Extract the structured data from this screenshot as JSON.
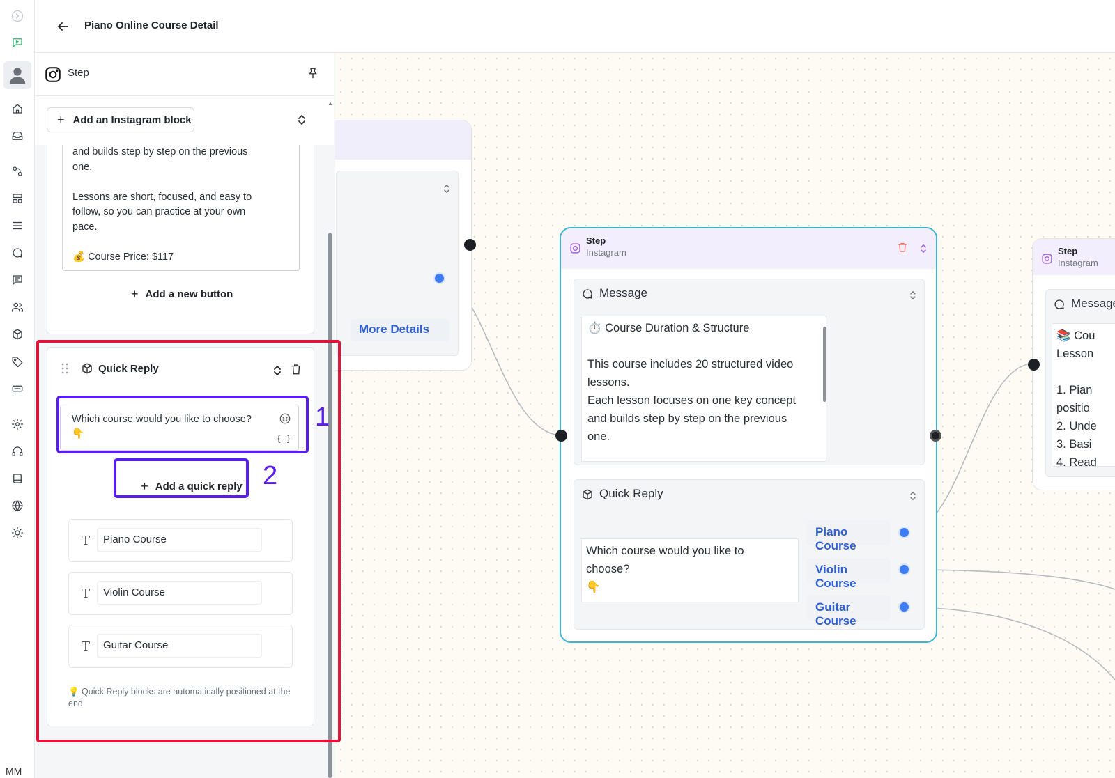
{
  "header": {
    "title": "Piano Online Course Detail"
  },
  "rail": {
    "user_initials": "MM"
  },
  "panel": {
    "step_label": "Step",
    "add_block_label": "Add an Instagram block",
    "message_text": "and builds step by step on the previous\none.\n\nLessons are short, focused, and easy to\nfollow, so you can practice at your own\npace.\n\n💰 Course Price: $117",
    "add_button_label": "Add a new button",
    "quick_reply": {
      "title": "Quick Reply",
      "input_value": "Which course would you like to choose?\n👇",
      "var_glyph": "{ }",
      "add_label": "Add a quick reply",
      "options": [
        "Piano Course",
        "Violin Course",
        "Guitar Course"
      ],
      "hint": "💡 Quick Reply blocks are automatically positioned at the end"
    }
  },
  "annotations": {
    "marker_1": "1",
    "marker_2": "2",
    "box_color": "#e2123a",
    "marker_color": "#5a1df0"
  },
  "canvas": {
    "node_a": {
      "button_label": "More Details"
    },
    "node_b": {
      "title": "Step",
      "subtitle": "Instagram",
      "message_section": "Message",
      "message_body": "⏱️ Course Duration & Structure\n\nThis course includes 20 structured video\nlessons.\nEach lesson focuses on one key concept\nand builds step by step on the previous\none.",
      "quick_reply_section": "Quick Reply",
      "quick_reply_text": "Which course would you like to\nchoose?\n👇",
      "chips": [
        "Piano Course",
        "Violin Course",
        "Guitar Course"
      ]
    },
    "node_c": {
      "title": "Step",
      "subtitle": "Instagram",
      "message_section": "Message",
      "preview": "📚 Cou\nLesson\n\n1. Pian\npositio\n2. Unde\n3. Basi\n4. Read"
    },
    "colors": {
      "accent_blue": "#2e5fd6",
      "selected_border": "#3fb4d6",
      "node_header": "#f2eefd"
    }
  }
}
